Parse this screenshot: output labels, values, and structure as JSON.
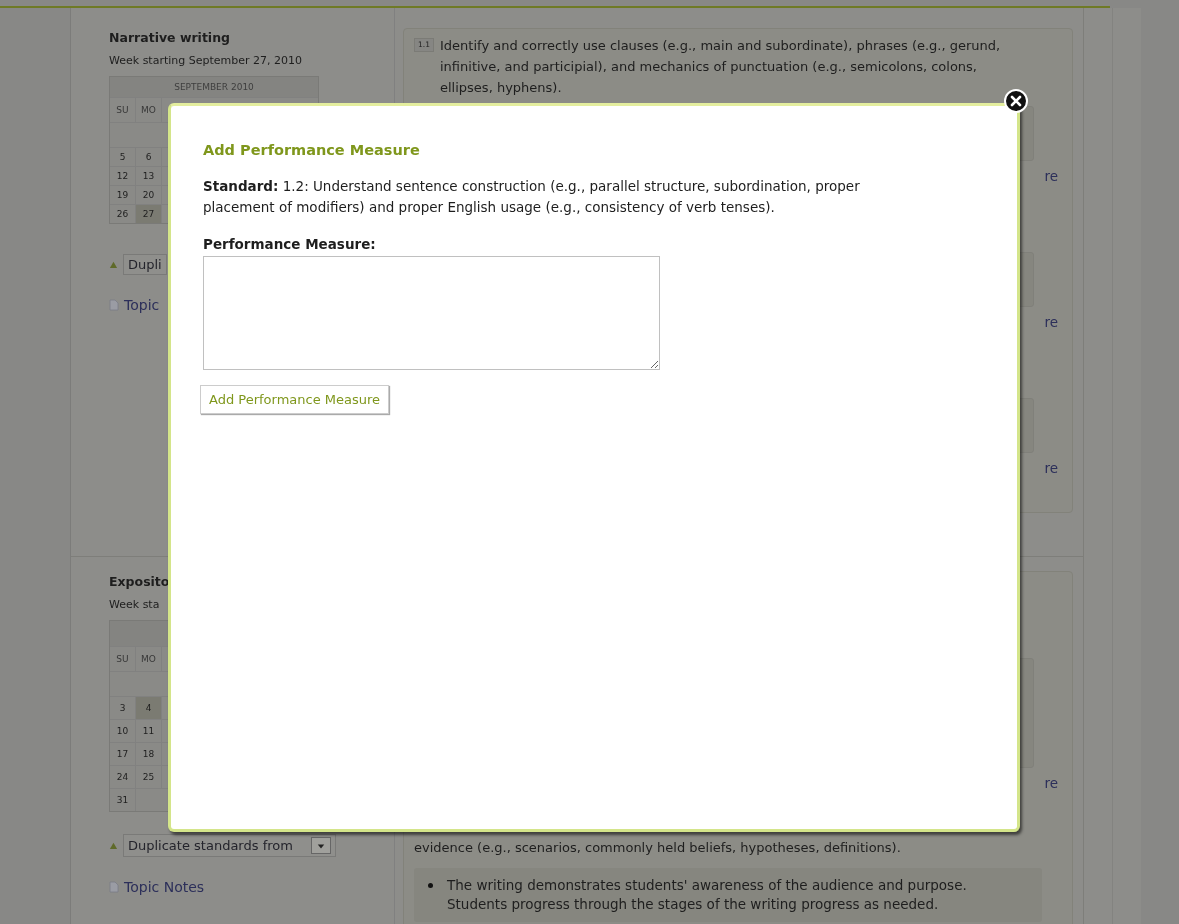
{
  "sections": [
    {
      "title": "Narrative writing",
      "week": "Week starting September 27, 2010",
      "calendar": {
        "month": "SEPTEMBER 2010",
        "days": [
          "SU",
          "MO"
        ],
        "weeks": [
          {
            "blank": true
          },
          {
            "blank": false,
            "cells": [
              {
                "day": "5",
                "selected": false
              },
              {
                "day": "6",
                "selected": false
              }
            ]
          },
          {
            "blank": false,
            "cells": [
              {
                "day": "12",
                "selected": false
              },
              {
                "day": "13",
                "selected": false
              }
            ]
          },
          {
            "blank": false,
            "cells": [
              {
                "day": "19",
                "selected": false
              },
              {
                "day": "20",
                "selected": false
              }
            ]
          },
          {
            "blank": false,
            "cells": [
              {
                "day": "26",
                "selected": false
              },
              {
                "day": "27",
                "selected": true
              }
            ]
          }
        ]
      },
      "duplicate": {
        "label": "Dupli",
        "arrow": false
      },
      "notes": "Topic",
      "standards": [
        {
          "code": "1.1",
          "text": "Identify and correctly use clauses (e.g., main and subordinate), phrases (e.g., gerund, infinitive, and participial), and mechanics of punctuation (e.g., semicolons, colons, ellipses, hyphens).",
          "measures": [
            {
              "link": "re"
            },
            {
              "link": "re"
            },
            {
              "link": "re"
            }
          ]
        }
      ]
    },
    {
      "title": "Exposito",
      "week": "Week sta",
      "calendar": {
        "days": [
          "SU",
          "MO"
        ],
        "weeks": [
          {
            "blank": true
          },
          {
            "blank": false,
            "cells": [
              {
                "day": "3",
                "selected": false
              },
              {
                "day": "4",
                "selected": true
              }
            ]
          },
          {
            "blank": false,
            "cells": [
              {
                "day": "10",
                "selected": false
              },
              {
                "day": "11",
                "selected": false
              }
            ]
          },
          {
            "blank": false,
            "cells": [
              {
                "day": "17",
                "selected": false
              },
              {
                "day": "18",
                "selected": false
              }
            ]
          },
          {
            "blank": false,
            "cells": [
              {
                "day": "24",
                "selected": false
              },
              {
                "day": "25",
                "selected": false
              }
            ]
          },
          {
            "blank": false,
            "cells": [
              {
                "day": "31",
                "selected": false
              }
            ]
          }
        ]
      },
      "duplicate": {
        "label": "Duplicate standards from",
        "arrow": true
      },
      "notes": "Topic Notes",
      "standards": [
        {
          "measures": [
            {
              "link": "re"
            }
          ]
        },
        {
          "text": "evidence (e.g., scenarios, commonly held beliefs, hypotheses, definitions).",
          "bullets": [
            "The writing demonstrates students' awareness of the audience and purpose. Students progress through the stages of the writing progress as needed."
          ]
        }
      ]
    }
  ],
  "dialog": {
    "title": "Add Performance Measure",
    "standard": "**Standard:** 1.2: Understand sentence construction (e.g., parallel structure, subordination, proper placement of modifiers) and proper English usage (e.g., consistency of verb tenses).",
    "field_label": "Performance Measure:",
    "button": "Add Performance Measure"
  }
}
